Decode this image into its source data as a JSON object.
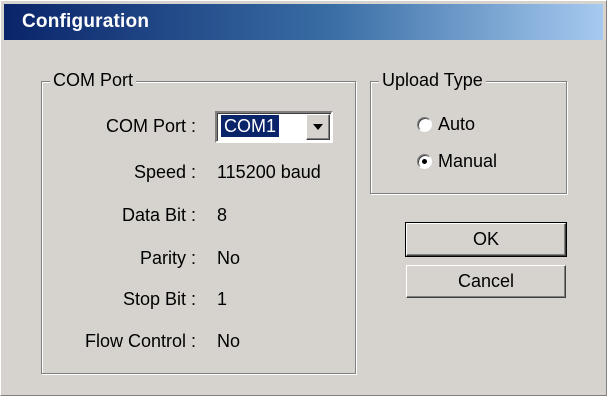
{
  "window": {
    "title": "Configuration"
  },
  "com_group": {
    "legend": "COM Port",
    "fields": [
      {
        "label": "COM Port :",
        "value": "COM1"
      },
      {
        "label": "Speed :",
        "value": "115200 baud"
      },
      {
        "label": "Data Bit :",
        "value": "8"
      },
      {
        "label": "Parity :",
        "value": "No"
      },
      {
        "label": "Stop Bit :",
        "value": "1"
      },
      {
        "label": "Flow Control :",
        "value": "No"
      }
    ]
  },
  "upload_group": {
    "legend": "Upload Type",
    "options": [
      {
        "label": "Auto",
        "selected": false
      },
      {
        "label": "Manual",
        "selected": true
      }
    ]
  },
  "buttons": {
    "ok": "OK",
    "cancel": "Cancel"
  },
  "colors": {
    "titlebar_start": "#0a246a",
    "titlebar_end": "#a6caf0",
    "face": "#d6d3ce",
    "selection": "#0a246a"
  },
  "icons": {
    "combo_arrow": "chevron-down-icon",
    "radio_dot": "radio-dot-icon"
  }
}
